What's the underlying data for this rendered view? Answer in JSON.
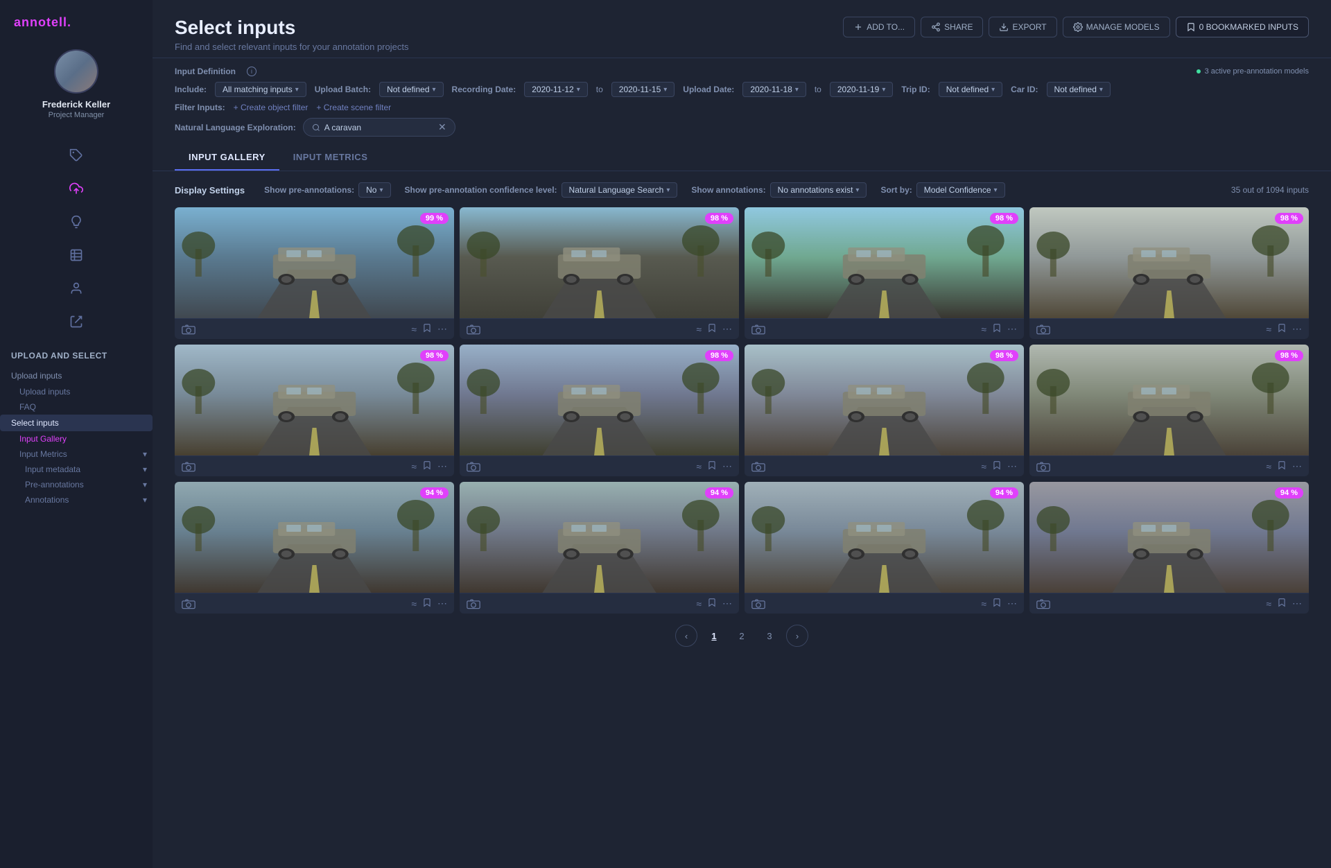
{
  "app": {
    "name": "annotell",
    "name_suffix": "."
  },
  "user": {
    "name": "Frederick Keller",
    "role": "Project Manager"
  },
  "sidebar": {
    "sections": [
      {
        "title": "Upload and Select",
        "items": [
          {
            "label": "Upload inputs",
            "active": false,
            "sub": [
              {
                "label": "Upload inputs"
              },
              {
                "label": "FAQ"
              }
            ]
          },
          {
            "label": "Select inputs",
            "active": true,
            "sub": [
              {
                "label": "Input Gallery",
                "active": true
              },
              {
                "label": "Input Metrics",
                "active": false
              }
            ]
          }
        ]
      }
    ],
    "sub_items": [
      {
        "label": "Input metadata"
      },
      {
        "label": "Pre-annotations"
      },
      {
        "label": "Annotations"
      }
    ]
  },
  "topbar": {
    "title": "Select inputs",
    "subtitle": "Find and select relevant inputs for your annotation projects",
    "buttons": {
      "add_to": "ADD TO...",
      "share": "SHARE",
      "export": "EXPORT",
      "manage_models": "MANAGE MODELS",
      "bookmarked": "0 BOOKMARKED INPUTS"
    }
  },
  "filter": {
    "input_definition_label": "Input Definition",
    "active_models": "3 active pre-annotation models",
    "include_label": "Include:",
    "include_value": "All matching inputs",
    "upload_batch_label": "Upload Batch:",
    "upload_batch_value": "Not defined",
    "recording_date_label": "Recording Date:",
    "recording_date_from": "2020-11-12",
    "recording_date_to": "2020-11-15",
    "to_label": "to",
    "upload_date_label": "Upload Date:",
    "upload_date_from": "2020-11-18",
    "upload_date_to": "2020-11-19",
    "trip_id_label": "Trip ID:",
    "trip_id_value": "Not defined",
    "car_id_label": "Car ID:",
    "car_id_value": "Not defined",
    "filter_inputs_label": "Filter Inputs:",
    "create_object_filter": "+ Create object filter",
    "create_scene_filter": "+ Create scene filter",
    "nl_label": "Natural Language Exploration:",
    "nl_value": "A caravan"
  },
  "tabs": [
    {
      "label": "INPUT GALLERY",
      "active": true
    },
    {
      "label": "INPUT METRICS",
      "active": false
    }
  ],
  "display_settings": {
    "title": "Display Settings",
    "show_pre_annotations_label": "Show pre-annotations:",
    "show_pre_annotations_value": "No",
    "show_confidence_label": "Show pre-annotation confidence level:",
    "show_confidence_value": "Natural Language Search",
    "show_annotations_label": "Show annotations:",
    "show_annotations_value": "No annotations exist",
    "sort_by_label": "Sort by:",
    "sort_by_value": "Model Confidence",
    "results_count": "35 out of 1094 inputs"
  },
  "images": [
    {
      "confidence": "99 %",
      "scene": "scene-1"
    },
    {
      "confidence": "98 %",
      "scene": "scene-2"
    },
    {
      "confidence": "98 %",
      "scene": "scene-3"
    },
    {
      "confidence": "98 %",
      "scene": "scene-4"
    },
    {
      "confidence": "98 %",
      "scene": "scene-5"
    },
    {
      "confidence": "98 %",
      "scene": "scene-6"
    },
    {
      "confidence": "98 %",
      "scene": "scene-7"
    },
    {
      "confidence": "98 %",
      "scene": "scene-8"
    },
    {
      "confidence": "94 %",
      "scene": "scene-9"
    },
    {
      "confidence": "94 %",
      "scene": "scene-10"
    },
    {
      "confidence": "94 %",
      "scene": "scene-11"
    },
    {
      "confidence": "94 %",
      "scene": "scene-12"
    }
  ],
  "pagination": {
    "pages": [
      "1",
      "2",
      "3"
    ],
    "current": "1"
  },
  "icons": {
    "tag": "🏷",
    "upload": "⬆",
    "bulb": "💡",
    "table": "⊞",
    "person": "👤",
    "export_arrow": "→",
    "bookmark": "🔖",
    "camera": "📷",
    "similar": "≈",
    "more": "⋯",
    "chevron_down": "▾",
    "search": "🔍",
    "close": "✕",
    "info": "i",
    "clock": "⏱",
    "chevron_right": "›",
    "chevron_left": "‹",
    "plus": "+",
    "check": "✓"
  },
  "colors": {
    "accent": "#e040fb",
    "active_tab": "#5a6ef0",
    "badge_bg": "#e040fb",
    "sidebar_bg": "#1a1f2e",
    "main_bg": "#1e2433",
    "card_bg": "#252d40"
  }
}
